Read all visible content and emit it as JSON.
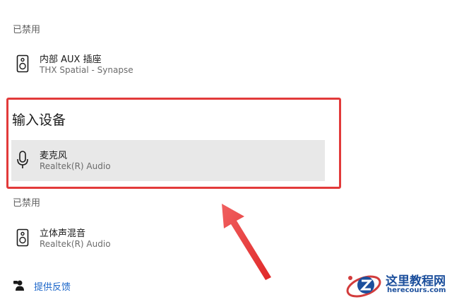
{
  "output_disabled": {
    "section_label": "已禁用",
    "device": {
      "name": "内部 AUX 插座",
      "subtitle": "THX Spatial - Synapse",
      "icon": "speaker-icon"
    }
  },
  "input_devices": {
    "header": "输入设备",
    "device": {
      "name": "麦克风",
      "subtitle": "Realtek(R) Audio",
      "icon": "microphone-icon"
    }
  },
  "input_disabled": {
    "section_label": "已禁用",
    "device": {
      "name": "立体声混音",
      "subtitle": "Realtek(R) Audio",
      "icon": "speaker-icon"
    }
  },
  "feedback": {
    "label": "提供反馈",
    "icon": "feedback-icon"
  },
  "watermark": {
    "title": "这里教程网",
    "url": "herecours.com"
  },
  "colors": {
    "highlight": "#e23a3a",
    "link": "#1a65c9",
    "selected_row": "#e8e8e8",
    "watermark": "#1c4f9c"
  }
}
